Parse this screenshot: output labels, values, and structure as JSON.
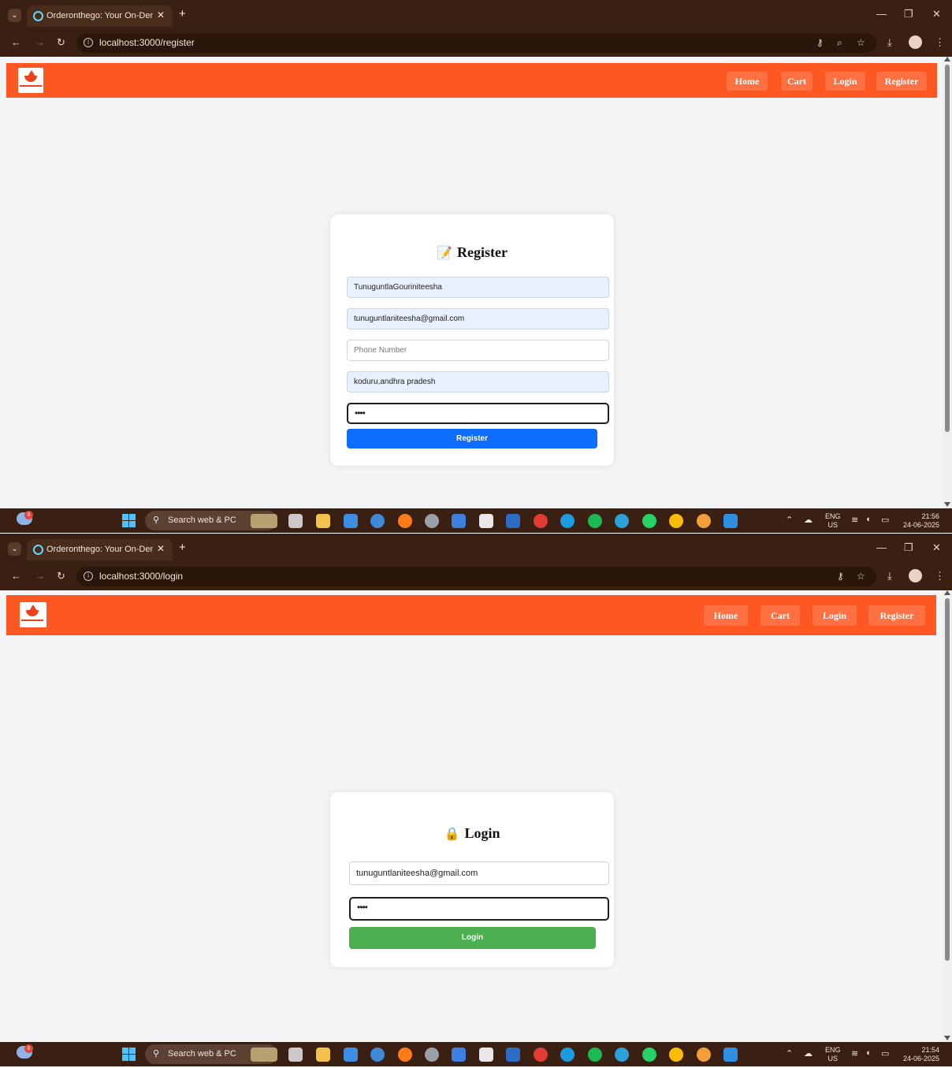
{
  "colors": {
    "brand": "#ff5722",
    "nav_button": "#ff7043",
    "register_button": "#0d6efd",
    "login_button": "#4caf50",
    "autofill": "#e8f0fe",
    "browser_frame": "#3a2012"
  },
  "screens": [
    {
      "browser": {
        "tab_title": "Orderonthego: Your On-Deman",
        "url": "localhost:3000/register"
      },
      "navbar": {
        "links": [
          "Home",
          "Cart",
          "Login",
          "Register"
        ]
      },
      "form": {
        "icon": "pencil-memo-icon",
        "title": "Register",
        "fields": [
          {
            "name": "username",
            "value": "TunuguntlaGouriniteesha",
            "placeholder": ""
          },
          {
            "name": "email",
            "value": "tunuguntlaniteesha@gmail.com",
            "placeholder": ""
          },
          {
            "name": "phone",
            "value": "",
            "placeholder": "Phone Number"
          },
          {
            "name": "address",
            "value": "koduru,andhra pradesh",
            "placeholder": ""
          },
          {
            "name": "password",
            "value": "••••",
            "placeholder": ""
          }
        ],
        "submit_label": "Register"
      },
      "taskbar": {
        "weather_badge": "8",
        "search_label": "Search web & PC",
        "lang": "ENG",
        "region": "US",
        "time": "21:56",
        "date": "24-06-2025"
      }
    },
    {
      "browser": {
        "tab_title": "Orderonthego: Your On-Deman",
        "url": "localhost:3000/login"
      },
      "navbar": {
        "links": [
          "Home",
          "Cart",
          "Login",
          "Register"
        ]
      },
      "form": {
        "icon": "lock-icon",
        "title": "Login",
        "fields": [
          {
            "name": "email",
            "value": "tunuguntlaniteesha@gmail.com",
            "placeholder": ""
          },
          {
            "name": "password",
            "value": "••••",
            "placeholder": ""
          }
        ],
        "submit_label": "Login"
      },
      "taskbar": {
        "weather_badge": "8",
        "search_label": "Search web & PC",
        "lang": "ENG",
        "region": "US",
        "time": "21:54",
        "date": "24-06-2025"
      }
    }
  ]
}
